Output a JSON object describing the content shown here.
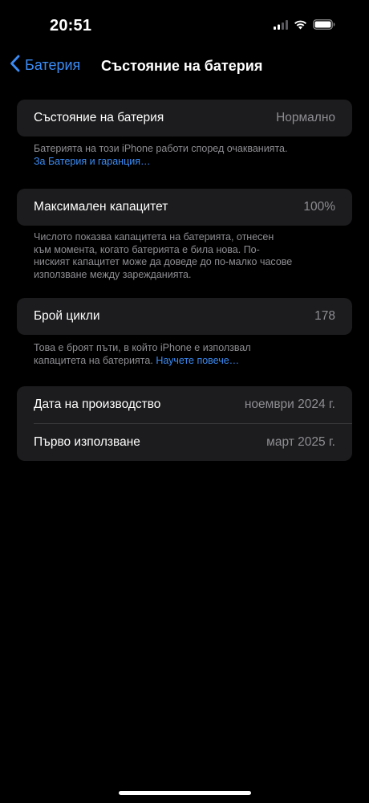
{
  "status_bar": {
    "time": "20:51"
  },
  "nav": {
    "back_label": "Батерия",
    "title": "Състояние на батерия"
  },
  "battery_condition": {
    "label": "Състояние на батерия",
    "value": "Нормално",
    "footnote": "Батерията на този iPhone работи според очакванията.",
    "link": "За Батерия и гаранция…"
  },
  "max_capacity": {
    "label": "Максимален капацитет",
    "value": "100%",
    "footnote_lines": [
      "Числото показва капацитета на батерията, отнесен",
      "към момента, когато батерията е била нова. По-",
      "ниският капацитет може да доведе до по-малко часове",
      "използване между зарежданията."
    ]
  },
  "cycle_count": {
    "label": "Брой цикли",
    "value": "178",
    "footnote_line1": "Това е броят пъти, в който iPhone е използвал",
    "footnote_line2": "капацитета на батерията.",
    "link": "Научете повече…"
  },
  "dates": {
    "manufacture_label": "Дата на производство",
    "manufacture_value": "ноември 2024 г.",
    "first_use_label": "Първо използване",
    "first_use_value": "март 2025 г."
  },
  "colors": {
    "accent": "#3b8cf5",
    "background": "#000000",
    "cell": "#1c1c1e",
    "secondary_text": "#8e8e93"
  },
  "icons": [
    "signal-icon",
    "wifi-icon",
    "battery-icon",
    "chevron-left-icon"
  ]
}
